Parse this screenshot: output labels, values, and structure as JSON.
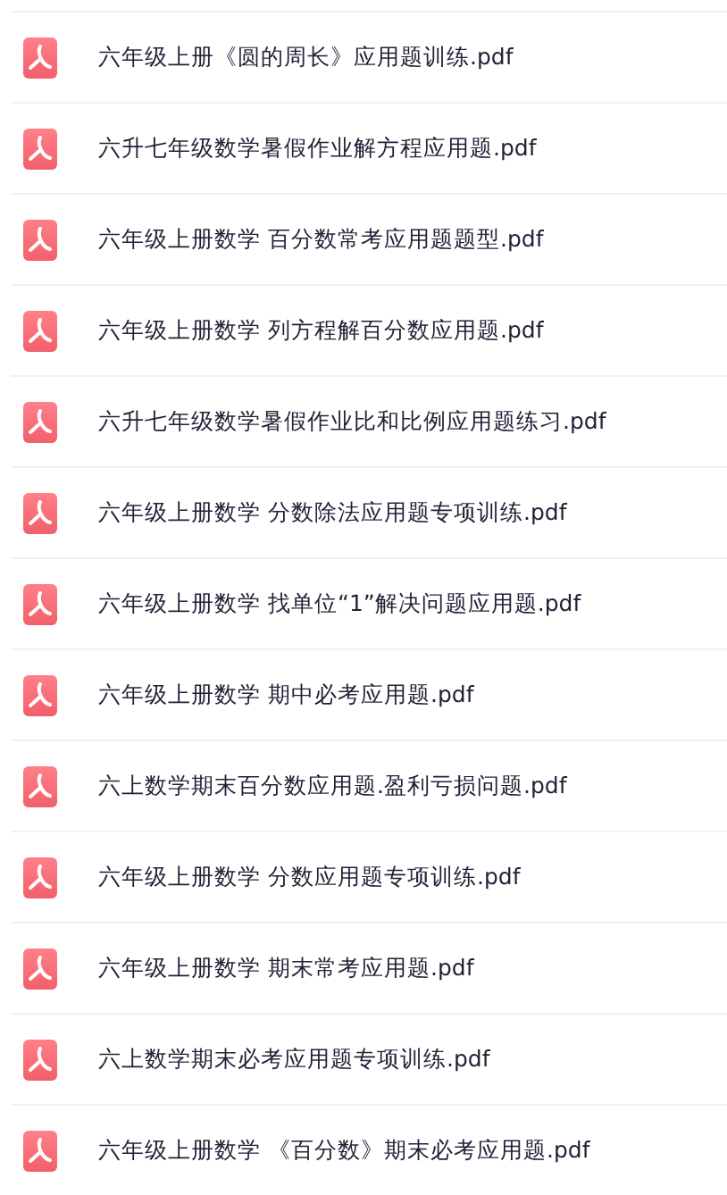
{
  "files": [
    {
      "name": "六年级上册《圆的周长》应用题训练.pdf",
      "kind": "pdf"
    },
    {
      "name": "六升七年级数学暑假作业解方程应用题.pdf",
      "kind": "pdf"
    },
    {
      "name": "六年级上册数学 百分数常考应用题题型.pdf",
      "kind": "pdf"
    },
    {
      "name": "六年级上册数学 列方程解百分数应用题.pdf",
      "kind": "pdf"
    },
    {
      "name": "六升七年级数学暑假作业比和比例应用题练习.pdf",
      "kind": "pdf"
    },
    {
      "name": "六年级上册数学 分数除法应用题专项训练.pdf",
      "kind": "pdf"
    },
    {
      "name": "六年级上册数学 找单位“1”解决问题应用题.pdf",
      "kind": "pdf"
    },
    {
      "name": "六年级上册数学 期中必考应用题.pdf",
      "kind": "pdf"
    },
    {
      "name": "六上数学期末百分数应用题.盈利亏损问题.pdf",
      "kind": "pdf"
    },
    {
      "name": "六年级上册数学 分数应用题专项训练.pdf",
      "kind": "pdf"
    },
    {
      "name": "六年级上册数学 期末常考应用题.pdf",
      "kind": "pdf"
    },
    {
      "name": "六上数学期末必考应用题专项训练.pdf",
      "kind": "pdf"
    },
    {
      "name": "六年级上册数学 《百分数》期末必考应用题.pdf",
      "kind": "pdf"
    }
  ]
}
